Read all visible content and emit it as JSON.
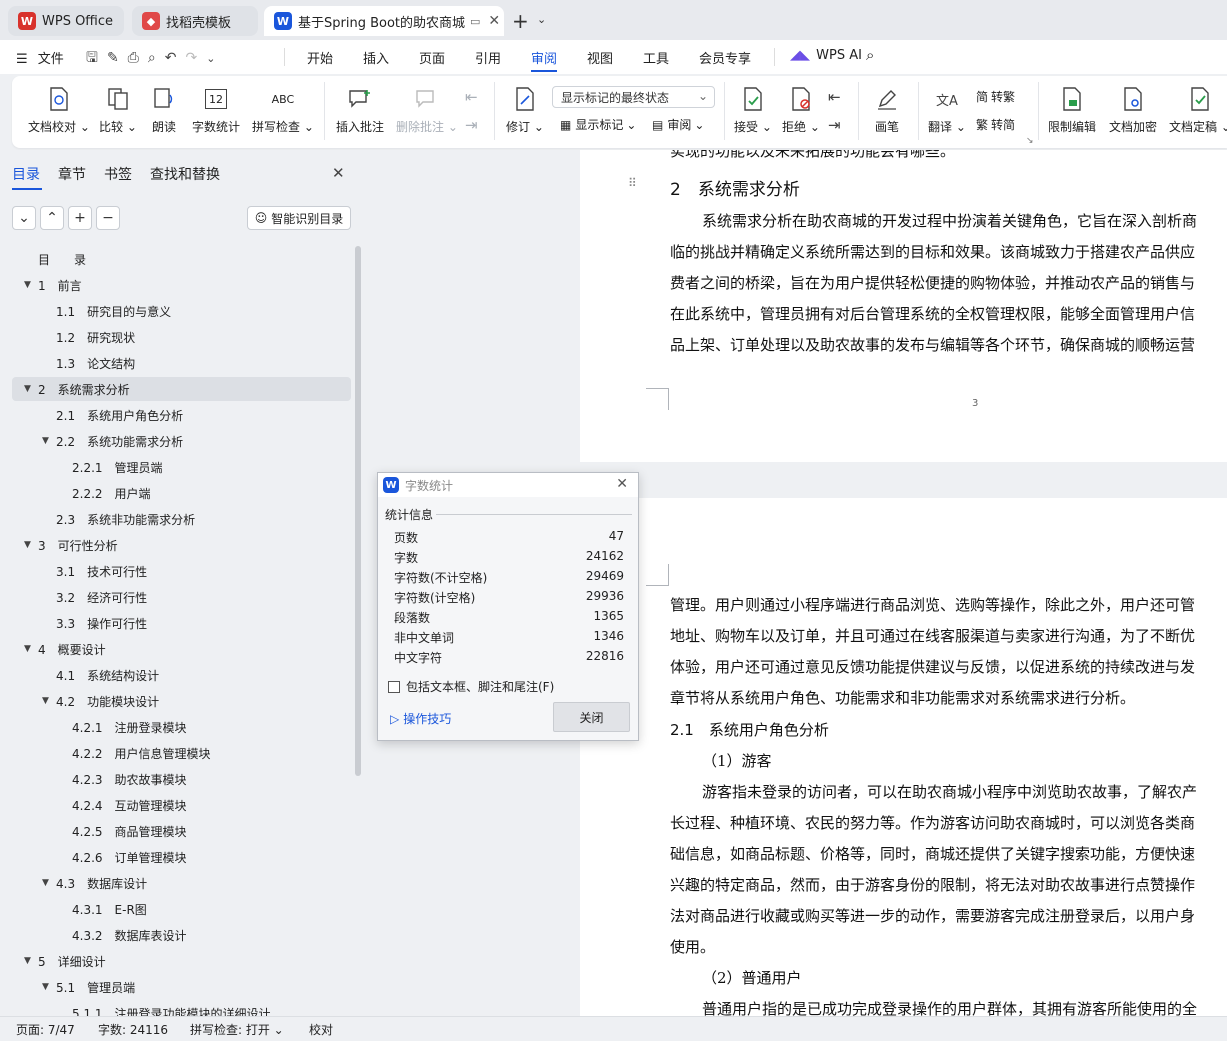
{
  "tabs": [
    {
      "label": "WPS Office",
      "icon": "wps-logo-icon",
      "color": "#d8322c"
    },
    {
      "label": "找稻壳模板",
      "icon": "docer-icon",
      "color": "#e04848"
    },
    {
      "label": "基于Spring Boot的助农商城",
      "icon": "word-doc-icon",
      "color": "#1a56db"
    }
  ],
  "menubar": {
    "file_label": "文件",
    "items": [
      "开始",
      "插入",
      "页面",
      "引用",
      "审阅",
      "视图",
      "工具",
      "会员专享"
    ],
    "active_item": "审阅",
    "ai_label": "WPS AI"
  },
  "ribbon": {
    "proofread": "文档校对",
    "compare": "比较",
    "read_aloud": "朗读",
    "word_count": "字数统计",
    "word_count_num": "12",
    "spell_check": "拼写检查",
    "spell_icon_text": "ABC",
    "insert_comment": "插入批注",
    "delete_comment": "删除批注",
    "revise": "修订",
    "markup_combo": "显示标记的最终状态",
    "show_markup": "显示标记",
    "review": "审阅",
    "accept": "接受",
    "reject": "拒绝",
    "pen": "画笔",
    "translate": "翻译",
    "to_traditional": "转繁",
    "to_simplified": "转简",
    "restrict_edit": "限制编辑",
    "encrypt": "文档加密",
    "finalize": "文档定稿"
  },
  "sidebar": {
    "tabs": [
      "目录",
      "章节",
      "书签",
      "查找和替换"
    ],
    "active_tab": "目录",
    "smart_toc_label": "智能识别目录",
    "toc": [
      {
        "label": "目　　录",
        "level": 0,
        "arrow": ""
      },
      {
        "label": "1　前言",
        "level": 1,
        "arrow": "▼"
      },
      {
        "label": "1.1　研究目的与意义",
        "level": 2,
        "arrow": ""
      },
      {
        "label": "1.2　研究现状",
        "level": 2,
        "arrow": ""
      },
      {
        "label": "1.3　论文结构",
        "level": 2,
        "arrow": ""
      },
      {
        "label": "2　系统需求分析",
        "level": 1,
        "arrow": "▼",
        "selected": true
      },
      {
        "label": "2.1　系统用户角色分析",
        "level": 2,
        "arrow": ""
      },
      {
        "label": "2.2　系统功能需求分析",
        "level": 2,
        "arrow": "▼"
      },
      {
        "label": "2.2.1　管理员端",
        "level": 3,
        "arrow": ""
      },
      {
        "label": "2.2.2　用户端",
        "level": 3,
        "arrow": ""
      },
      {
        "label": "2.3　系统非功能需求分析",
        "level": 2,
        "arrow": ""
      },
      {
        "label": "3　可行性分析",
        "level": 1,
        "arrow": "▼"
      },
      {
        "label": "3.1　技术可行性",
        "level": 2,
        "arrow": ""
      },
      {
        "label": "3.2　经济可行性",
        "level": 2,
        "arrow": ""
      },
      {
        "label": "3.3　操作可行性",
        "level": 2,
        "arrow": ""
      },
      {
        "label": "4　概要设计",
        "level": 1,
        "arrow": "▼"
      },
      {
        "label": "4.1　系统结构设计",
        "level": 2,
        "arrow": ""
      },
      {
        "label": "4.2　功能模块设计",
        "level": 2,
        "arrow": "▼"
      },
      {
        "label": "4.2.1　注册登录模块",
        "level": 3,
        "arrow": ""
      },
      {
        "label": "4.2.2　用户信息管理模块",
        "level": 3,
        "arrow": ""
      },
      {
        "label": "4.2.3　助农故事模块",
        "level": 3,
        "arrow": ""
      },
      {
        "label": "4.2.4　互动管理模块",
        "level": 3,
        "arrow": ""
      },
      {
        "label": "4.2.5　商品管理模块",
        "level": 3,
        "arrow": ""
      },
      {
        "label": "4.2.6　订单管理模块",
        "level": 3,
        "arrow": ""
      },
      {
        "label": "4.3　数据库设计",
        "level": 2,
        "arrow": "▼"
      },
      {
        "label": "4.3.1　E-R图",
        "level": 3,
        "arrow": ""
      },
      {
        "label": "4.3.2　数据库表设计",
        "level": 3,
        "arrow": ""
      },
      {
        "label": "5　详细设计",
        "level": 1,
        "arrow": "▼"
      },
      {
        "label": "5.1　管理员端",
        "level": 2,
        "arrow": "▼"
      },
      {
        "label": "5.1.1　注册登录功能模块的详细设计",
        "level": 3,
        "arrow": ""
      }
    ]
  },
  "document": {
    "page_top_lines": [
      "实现的功能以及未来拓展的功能会有哪些。",
      "系统需求分析在助农商城的开发过程中扮演着关键角色，它旨在深入剖析商",
      "临的挑战并精确定义系统所需达到的目标和效果。该商城致力于搭建农产品供应",
      "费者之间的桥梁，旨在为用户提供轻松便捷的购物体验，并推动农产品的销售与",
      "在此系统中，管理员拥有对后台管理系统的全权管理权限，能够全面管理用户信",
      "品上架、订单处理以及助农故事的发布与编辑等各个环节，确保商城的顺畅运营"
    ],
    "heading_2": "2　系统需求分析",
    "page_number": "3",
    "page_bottom_lines": [
      "管理。用户则通过小程序端进行商品浏览、选购等操作，除此之外，用户还可管",
      "地址、购物车以及订单，并且可通过在线客服渠道与卖家进行沟通，为了不断优",
      "体验，用户还可通过意见反馈功能提供建议与反馈，以促进系统的持续改进与发",
      "章节将从系统用户角色、功能需求和非功能需求对系统需求进行分析。"
    ],
    "heading_2_1": "2.1　系统用户角色分析",
    "role_1": "（1）游客",
    "guest_lines": [
      "游客指未登录的访问者，可以在助农商城小程序中浏览助农故事，了解农产",
      "长过程、种植环境、农民的努力等。作为游客访问助农商城时，可以浏览各类商",
      "础信息，如商品标题、价格等，同时，商城还提供了关键字搜索功能，方便快速",
      "兴趣的特定商品，然而，由于游客身份的限制，将无法对助农故事进行点赞操作",
      "法对商品进行收藏或购买等进一步的动作，需要游客完成注册登录后，以用户身",
      "使用。"
    ],
    "role_2": "（2）普通用户",
    "user_line": "普通用户指的是已成功完成登录操作的用户群体，其拥有游客所能使用的全"
  },
  "dialog": {
    "title": "字数统计",
    "section": "统计信息",
    "rows": [
      {
        "label": "页数",
        "value": "47"
      },
      {
        "label": "字数",
        "value": "24162"
      },
      {
        "label": "字符数(不计空格)",
        "value": "29469"
      },
      {
        "label": "字符数(计空格)",
        "value": "29936"
      },
      {
        "label": "段落数",
        "value": "1365"
      },
      {
        "label": "非中文单词",
        "value": "1346"
      },
      {
        "label": "中文字符",
        "value": "22816"
      }
    ],
    "checkbox_label": "包括文本框、脚注和尾注(F)",
    "tips_label": "操作技巧",
    "close_label": "关闭"
  },
  "status": {
    "page": "页面: 7/47",
    "words": "字数: 24116",
    "spell": "拼写检查: 打开",
    "proof": "校对"
  }
}
